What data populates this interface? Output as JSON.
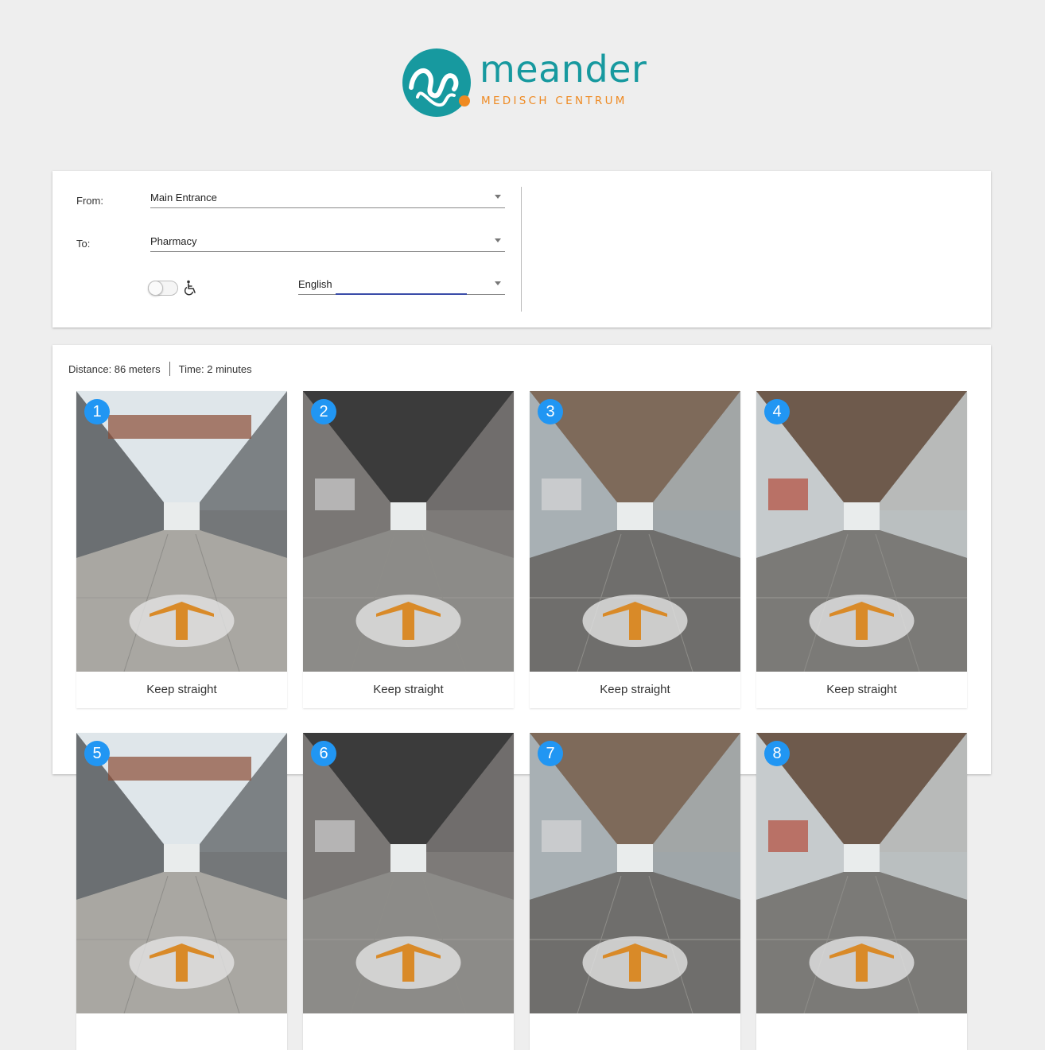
{
  "logo": {
    "word": "meander",
    "subtitle": "MEDISCH CENTRUM",
    "teal": "#17999f",
    "orange": "#ef8a22"
  },
  "form": {
    "from_label": "From:",
    "from_value": "Main Entrance",
    "to_label": "To:",
    "to_value": "Pharmacy",
    "language_value": "English",
    "wheelchair_toggle": false,
    "wheelchair_icon": "wheelchair-icon"
  },
  "route": {
    "distance": "Distance: 86 meters",
    "time": "Time: 2 minutes",
    "steps": [
      {
        "number": "1",
        "caption": "Keep straight"
      },
      {
        "number": "2",
        "caption": "Keep straight"
      },
      {
        "number": "3",
        "caption": "Keep straight"
      },
      {
        "number": "4",
        "caption": "Keep straight"
      },
      {
        "number": "5",
        "caption": ""
      },
      {
        "number": "6",
        "caption": ""
      },
      {
        "number": "7",
        "caption": ""
      },
      {
        "number": "8",
        "caption": ""
      }
    ]
  },
  "colors": {
    "badge": "#2196f3",
    "accent_line": "#3a4ca8",
    "arrow": "#d98a28"
  }
}
